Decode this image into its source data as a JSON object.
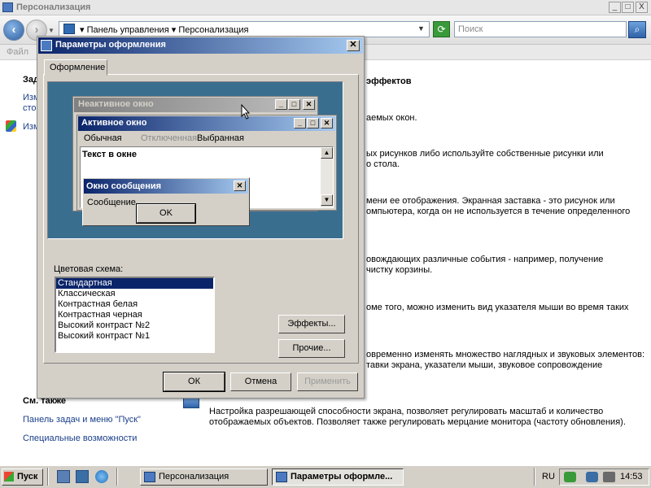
{
  "background_window": {
    "title": "Персонализация",
    "controls": {
      "minimize": "_",
      "maximize": "□",
      "close": "X"
    },
    "breadcrumb": [
      "Панель управления",
      "Персонализация"
    ],
    "breadcrumb_separator": "▾",
    "search_placeholder": "Поиск",
    "menu_file": "Файл",
    "left_fragments": [
      "Зад",
      "Изм",
      "сто",
      "Изм"
    ],
    "right_heading": "эффектов",
    "right_lines": [
      "аемых окон.",
      "ых рисунков либо используйте собственные рисунки или",
      "о стола.",
      "мени ее отображения. Экранная заставка - это рисунок или",
      "омпьютера, когда он не используется в течение определенного",
      "овождающих различные события - например, получение",
      "чистку корзины.",
      "оме того, можно изменить вид указателя мыши во время таких",
      "овременно изменять множество наглядных и звуковых элементов:",
      "тавки экрана, указатели мыши, звуковое сопровождение",
      "Настройка разрешающей способности экрана, позволяет регулировать масштаб и количество",
      "отображаемых объектов. Позволяет также регулировать мерцание монитора (частоту обновления)."
    ],
    "see_also_heading": "См. также",
    "see_also_links": [
      "Панель задач и меню \"Пуск\"",
      "Специальные возможности"
    ]
  },
  "dialog": {
    "title": "Параметры оформления",
    "tab": "Оформление",
    "preview": {
      "inactive_title": "Неактивное окно",
      "active_title": "Активное окно",
      "menu_items": [
        "Обычная",
        "Отключенная",
        "Выбранная"
      ],
      "window_text": "Текст в окне",
      "message_title": "Окно сообщения",
      "message_text": "Сообщение",
      "ok": "OK"
    },
    "color_scheme_label": "Цветовая схема:",
    "color_schemes": [
      "Стандартная",
      "Классическая",
      "Контрастная белая",
      "Контрастная черная",
      "Высокий контраст №2",
      "Высокий контраст №1"
    ],
    "selected_scheme": "Стандартная",
    "effects_button": "Эффекты...",
    "other_button": "Прочие...",
    "ok_button": "ОК",
    "cancel_button": "Отмена",
    "apply_button": "Применить"
  },
  "taskbar": {
    "start": "Пуск",
    "tasks": [
      "Персонализация",
      "Параметры оформле..."
    ],
    "language": "RU",
    "clock": "14:53"
  }
}
